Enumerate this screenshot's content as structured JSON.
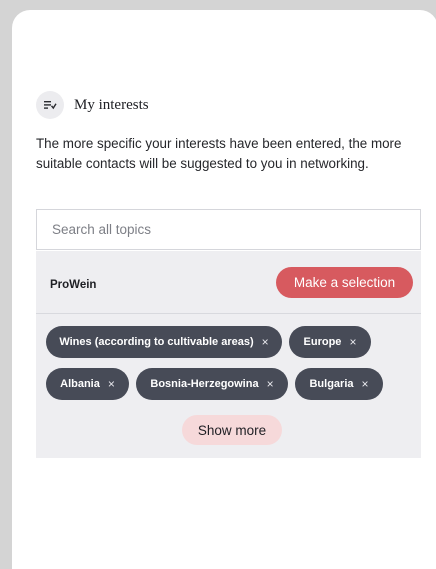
{
  "header": {
    "icon": "filter-list-icon",
    "title": "My interests"
  },
  "intro_text": "The more specific your interests have been entered, the more suitable contacts will be suggested to you in networking.",
  "search": {
    "placeholder": "Search all topics",
    "value": ""
  },
  "topic_group": {
    "name": "ProWein",
    "selection_button_label": "Make a selection",
    "chips": [
      {
        "label": "Wines (according to cultivable areas)",
        "remove": "×"
      },
      {
        "label": "Europe",
        "remove": "×"
      },
      {
        "label": "Albania",
        "remove": "×"
      },
      {
        "label": "Bosnia-Herzegowina",
        "remove": "×"
      },
      {
        "label": "Bulgaria",
        "remove": "×"
      }
    ],
    "show_more_label": "Show more"
  },
  "colors": {
    "accent": "#d75a5f",
    "chip_bg": "#474b57",
    "show_more_bg": "#f6d9da",
    "panel_bg": "#eeeef1"
  }
}
